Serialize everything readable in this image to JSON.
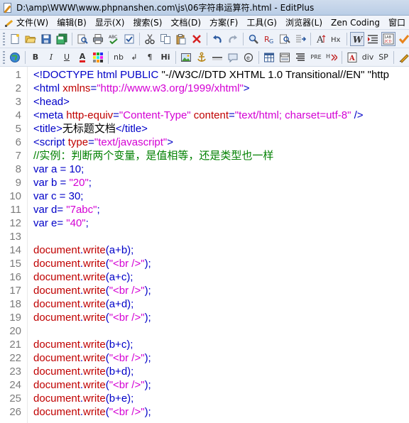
{
  "window": {
    "title": "D:\\amp\\WWW\\www.phpnanshen.com\\js\\06字符串运算符.html - EditPlus"
  },
  "menu": [
    {
      "label": "文件(W)",
      "icon": "file-menu-icon"
    },
    {
      "label": "编辑(B)"
    },
    {
      "label": "显示(X)"
    },
    {
      "label": "搜索(S)"
    },
    {
      "label": "文档(D)"
    },
    {
      "label": "方案(F)"
    },
    {
      "label": "工具(G)"
    },
    {
      "label": "浏览器(L)"
    },
    {
      "label": "Zen Coding"
    },
    {
      "label": "窗口"
    }
  ],
  "toolbar1": [
    "new-file-icon",
    "open-file-icon",
    "save-icon",
    "save-all-icon",
    "sep",
    "print-preview-icon",
    "print-icon",
    "spell-check-icon",
    "check-icon",
    "sep",
    "cut-icon",
    "copy-icon",
    "paste-icon",
    "delete-icon",
    "sep",
    "undo-icon",
    "redo-icon",
    "sep",
    "find-icon",
    "replace-icon",
    "find-in-files-icon",
    "goto-icon",
    "sep",
    "font-size-icon",
    "hex-icon",
    "sep",
    "word-wrap-icon",
    "indent-icon",
    "column-icon",
    "checkmark-icon"
  ],
  "toolbar2": [
    "browser-icon",
    "sep",
    "bold-icon",
    "italic-icon",
    "underline-icon",
    "font-color-icon",
    "color-grid-icon",
    "sep",
    "nbsp-icon",
    "break-icon",
    "paragraph-icon",
    "heading-icon",
    "sep",
    "image-icon",
    "anchor-icon",
    "line-icon",
    "comment-icon",
    "entity-icon",
    "sep",
    "table-icon",
    "form-icon",
    "list-icon",
    "pre-icon",
    "rule-icon",
    "sep",
    "spell-icon",
    "div-icon",
    "span-icon",
    "sep",
    "editor-icon"
  ],
  "toolbar2_glyphs": {
    "bold-icon": "B",
    "italic-icon": "I",
    "underline-icon": "U",
    "font-color-icon": "A",
    "nbsp-icon": "nb",
    "break-icon": "↲",
    "paragraph-icon": "¶",
    "heading-icon": "Hi",
    "pre-icon": "PRE",
    "div-icon": "div",
    "span-icon": "SP"
  },
  "toolbar1_glyphs": {
    "font-size-icon": "A",
    "hex-icon": "Hx",
    "word-wrap-icon": "W"
  },
  "colors": {
    "tag": "#0000c8",
    "attribute": "#c00000",
    "string": "#d400d4",
    "comment": "#008000",
    "line_number": "#7b7b7b"
  },
  "editor": {
    "lines": [
      {
        "n": "1",
        "tokens": [
          [
            "tag",
            "<!DOCTYPE html PUBLIC "
          ],
          [
            "txt",
            "\"-//W3C//DTD XHTML 1.0 Transitional//EN\" \"http"
          ]
        ]
      },
      {
        "n": "2",
        "tokens": [
          [
            "tag",
            "<html "
          ],
          [
            "attr",
            "xmlns"
          ],
          [
            "tag",
            "="
          ],
          [
            "str",
            "\"http://www.w3.org/1999/xhtml\""
          ],
          [
            "tag",
            ">"
          ]
        ]
      },
      {
        "n": "3",
        "tokens": [
          [
            "tag",
            "<head>"
          ]
        ]
      },
      {
        "n": "4",
        "tokens": [
          [
            "tag",
            "<meta "
          ],
          [
            "attr",
            "http-equiv"
          ],
          [
            "tag",
            "="
          ],
          [
            "str",
            "\"Content-Type\""
          ],
          [
            "tag",
            " "
          ],
          [
            "attr",
            "content"
          ],
          [
            "tag",
            "="
          ],
          [
            "str",
            "\"text/html; charset=utf-8\""
          ],
          [
            "tag",
            " />"
          ]
        ]
      },
      {
        "n": "5",
        "tokens": [
          [
            "tag",
            "<title>"
          ],
          [
            "txt",
            "无标题文档"
          ],
          [
            "tag",
            "</title>"
          ]
        ]
      },
      {
        "n": "6",
        "tokens": [
          [
            "tag",
            "<script "
          ],
          [
            "attr",
            "type"
          ],
          [
            "tag",
            "="
          ],
          [
            "str",
            "\"text/javascript\""
          ],
          [
            "tag",
            ">"
          ]
        ]
      },
      {
        "n": "7",
        "tokens": [
          [
            "cmt",
            "//实例：判断两个变量，是值相等，还是类型也一样"
          ]
        ]
      },
      {
        "n": "8",
        "tokens": [
          [
            "kw",
            "var a = 10;"
          ]
        ]
      },
      {
        "n": "9",
        "tokens": [
          [
            "kw",
            "var b = "
          ],
          [
            "str",
            "\"20\""
          ],
          [
            "kw",
            ";"
          ]
        ]
      },
      {
        "n": "10",
        "tokens": [
          [
            "kw",
            "var c = 30;"
          ]
        ]
      },
      {
        "n": "11",
        "tokens": [
          [
            "kw",
            "var d= "
          ],
          [
            "str",
            "\"7abc\""
          ],
          [
            "kw",
            ";"
          ]
        ]
      },
      {
        "n": "12",
        "tokens": [
          [
            "kw",
            "var e= "
          ],
          [
            "str",
            "\"40\""
          ],
          [
            "kw",
            ";"
          ]
        ]
      },
      {
        "n": "13",
        "tokens": []
      },
      {
        "n": "14",
        "tokens": [
          [
            "id",
            "document"
          ],
          [
            "kw",
            "."
          ],
          [
            "id",
            "write"
          ],
          [
            "kw",
            "(a+b);"
          ]
        ]
      },
      {
        "n": "15",
        "tokens": [
          [
            "id",
            "document"
          ],
          [
            "kw",
            "."
          ],
          [
            "id",
            "write"
          ],
          [
            "kw",
            "("
          ],
          [
            "str",
            "\"<br />\""
          ],
          [
            "kw",
            ");"
          ]
        ]
      },
      {
        "n": "16",
        "tokens": [
          [
            "id",
            "document"
          ],
          [
            "kw",
            "."
          ],
          [
            "id",
            "write"
          ],
          [
            "kw",
            "(a+c);"
          ]
        ]
      },
      {
        "n": "17",
        "tokens": [
          [
            "id",
            "document"
          ],
          [
            "kw",
            "."
          ],
          [
            "id",
            "write"
          ],
          [
            "kw",
            "("
          ],
          [
            "str",
            "\"<br />\""
          ],
          [
            "kw",
            ");"
          ]
        ]
      },
      {
        "n": "18",
        "tokens": [
          [
            "id",
            "document"
          ],
          [
            "kw",
            "."
          ],
          [
            "id",
            "write"
          ],
          [
            "kw",
            "(a+d);"
          ]
        ]
      },
      {
        "n": "19",
        "tokens": [
          [
            "id",
            "document"
          ],
          [
            "kw",
            "."
          ],
          [
            "id",
            "write"
          ],
          [
            "kw",
            "("
          ],
          [
            "str",
            "\"<br />\""
          ],
          [
            "kw",
            ");"
          ]
        ]
      },
      {
        "n": "20",
        "tokens": []
      },
      {
        "n": "21",
        "tokens": [
          [
            "id",
            "document"
          ],
          [
            "kw",
            "."
          ],
          [
            "id",
            "write"
          ],
          [
            "kw",
            "(b+c);"
          ]
        ]
      },
      {
        "n": "22",
        "tokens": [
          [
            "id",
            "document"
          ],
          [
            "kw",
            "."
          ],
          [
            "id",
            "write"
          ],
          [
            "kw",
            "("
          ],
          [
            "str",
            "\"<br />\""
          ],
          [
            "kw",
            ");"
          ]
        ]
      },
      {
        "n": "23",
        "tokens": [
          [
            "id",
            "document"
          ],
          [
            "kw",
            "."
          ],
          [
            "id",
            "write"
          ],
          [
            "kw",
            "(b+d);"
          ]
        ]
      },
      {
        "n": "24",
        "tokens": [
          [
            "id",
            "document"
          ],
          [
            "kw",
            "."
          ],
          [
            "id",
            "write"
          ],
          [
            "kw",
            "("
          ],
          [
            "str",
            "\"<br />\""
          ],
          [
            "kw",
            ");"
          ]
        ]
      },
      {
        "n": "25",
        "tokens": [
          [
            "id",
            "document"
          ],
          [
            "kw",
            "."
          ],
          [
            "id",
            "write"
          ],
          [
            "kw",
            "(b+e);"
          ]
        ]
      },
      {
        "n": "26",
        "tokens": [
          [
            "id",
            "document"
          ],
          [
            "kw",
            "."
          ],
          [
            "id",
            "write"
          ],
          [
            "kw",
            "("
          ],
          [
            "str",
            "\"<br />\""
          ],
          [
            "kw",
            ");"
          ]
        ]
      }
    ]
  }
}
